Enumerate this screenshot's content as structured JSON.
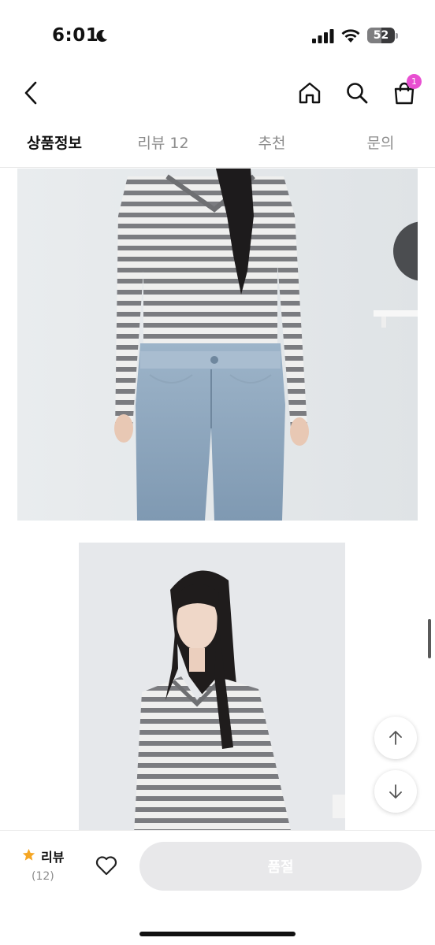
{
  "status": {
    "time": "6:01",
    "battery_level": "52",
    "battery_fraction": 0.52
  },
  "header": {
    "cart_badge_count": "1"
  },
  "tabs": [
    {
      "label": "상품정보",
      "active": true
    },
    {
      "label": "리뷰 12",
      "active": false
    },
    {
      "label": "추천",
      "active": false
    },
    {
      "label": "문의",
      "active": false
    }
  ],
  "bottom": {
    "review_label": "리뷰",
    "review_count": "(12)",
    "action_label": "품절"
  },
  "colors": {
    "accent_badge": "#e84fd1",
    "star": "#f5a623",
    "soldout_bg": "#e8e8ea"
  },
  "icons": [
    "moon-icon",
    "signal-icon",
    "wifi-icon",
    "battery-icon",
    "back-arrow-icon",
    "home-icon",
    "search-icon",
    "shopping-bag-icon",
    "arrow-up-icon",
    "arrow-down-icon",
    "star-icon",
    "heart-icon"
  ]
}
